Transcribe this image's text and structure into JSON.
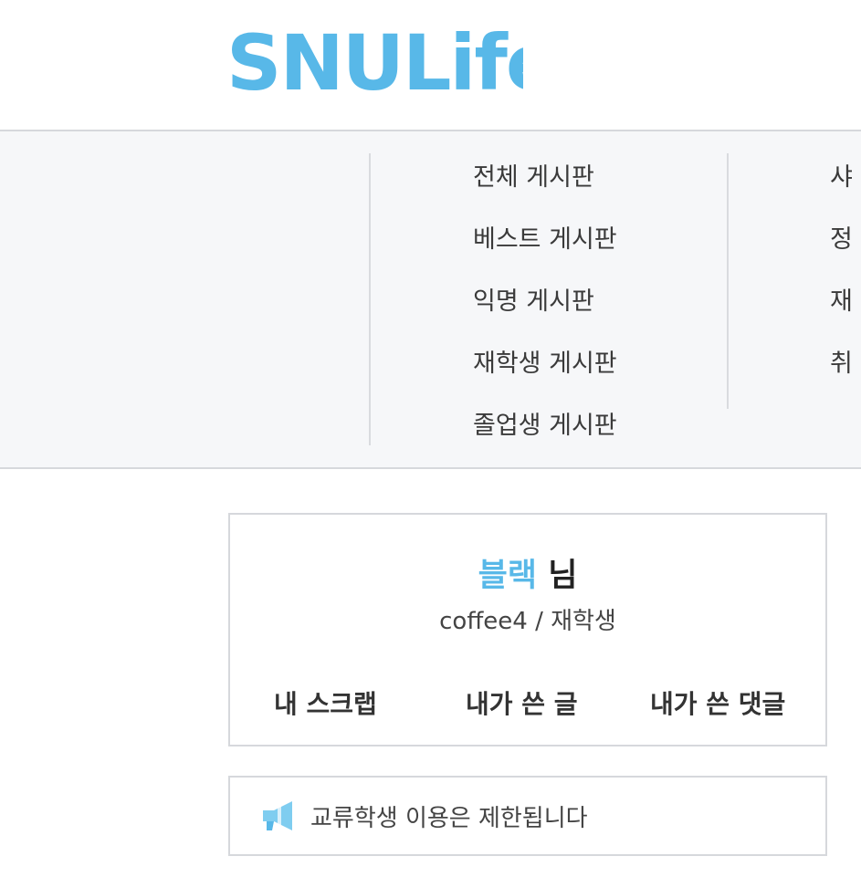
{
  "header": {
    "logo_text": "SNULife",
    "brand_color": "#58b8e8"
  },
  "menu": {
    "column1": [
      "전체 게시판",
      "베스트 게시판",
      "익명 게시판",
      "재학생 게시판",
      "졸업생 게시판"
    ],
    "column2_partial": [
      "샤",
      "정",
      "재",
      "취"
    ]
  },
  "user_card": {
    "nickname": "블랙",
    "honorific": "님",
    "username": "coffee4",
    "separator": "/",
    "status": "재학생",
    "links": [
      "내 스크랩",
      "내가 쓴 글",
      "내가 쓴 댓글"
    ]
  },
  "notice": {
    "icon": "megaphone-icon",
    "text": "교류학생 이용은 제한됩니다"
  }
}
